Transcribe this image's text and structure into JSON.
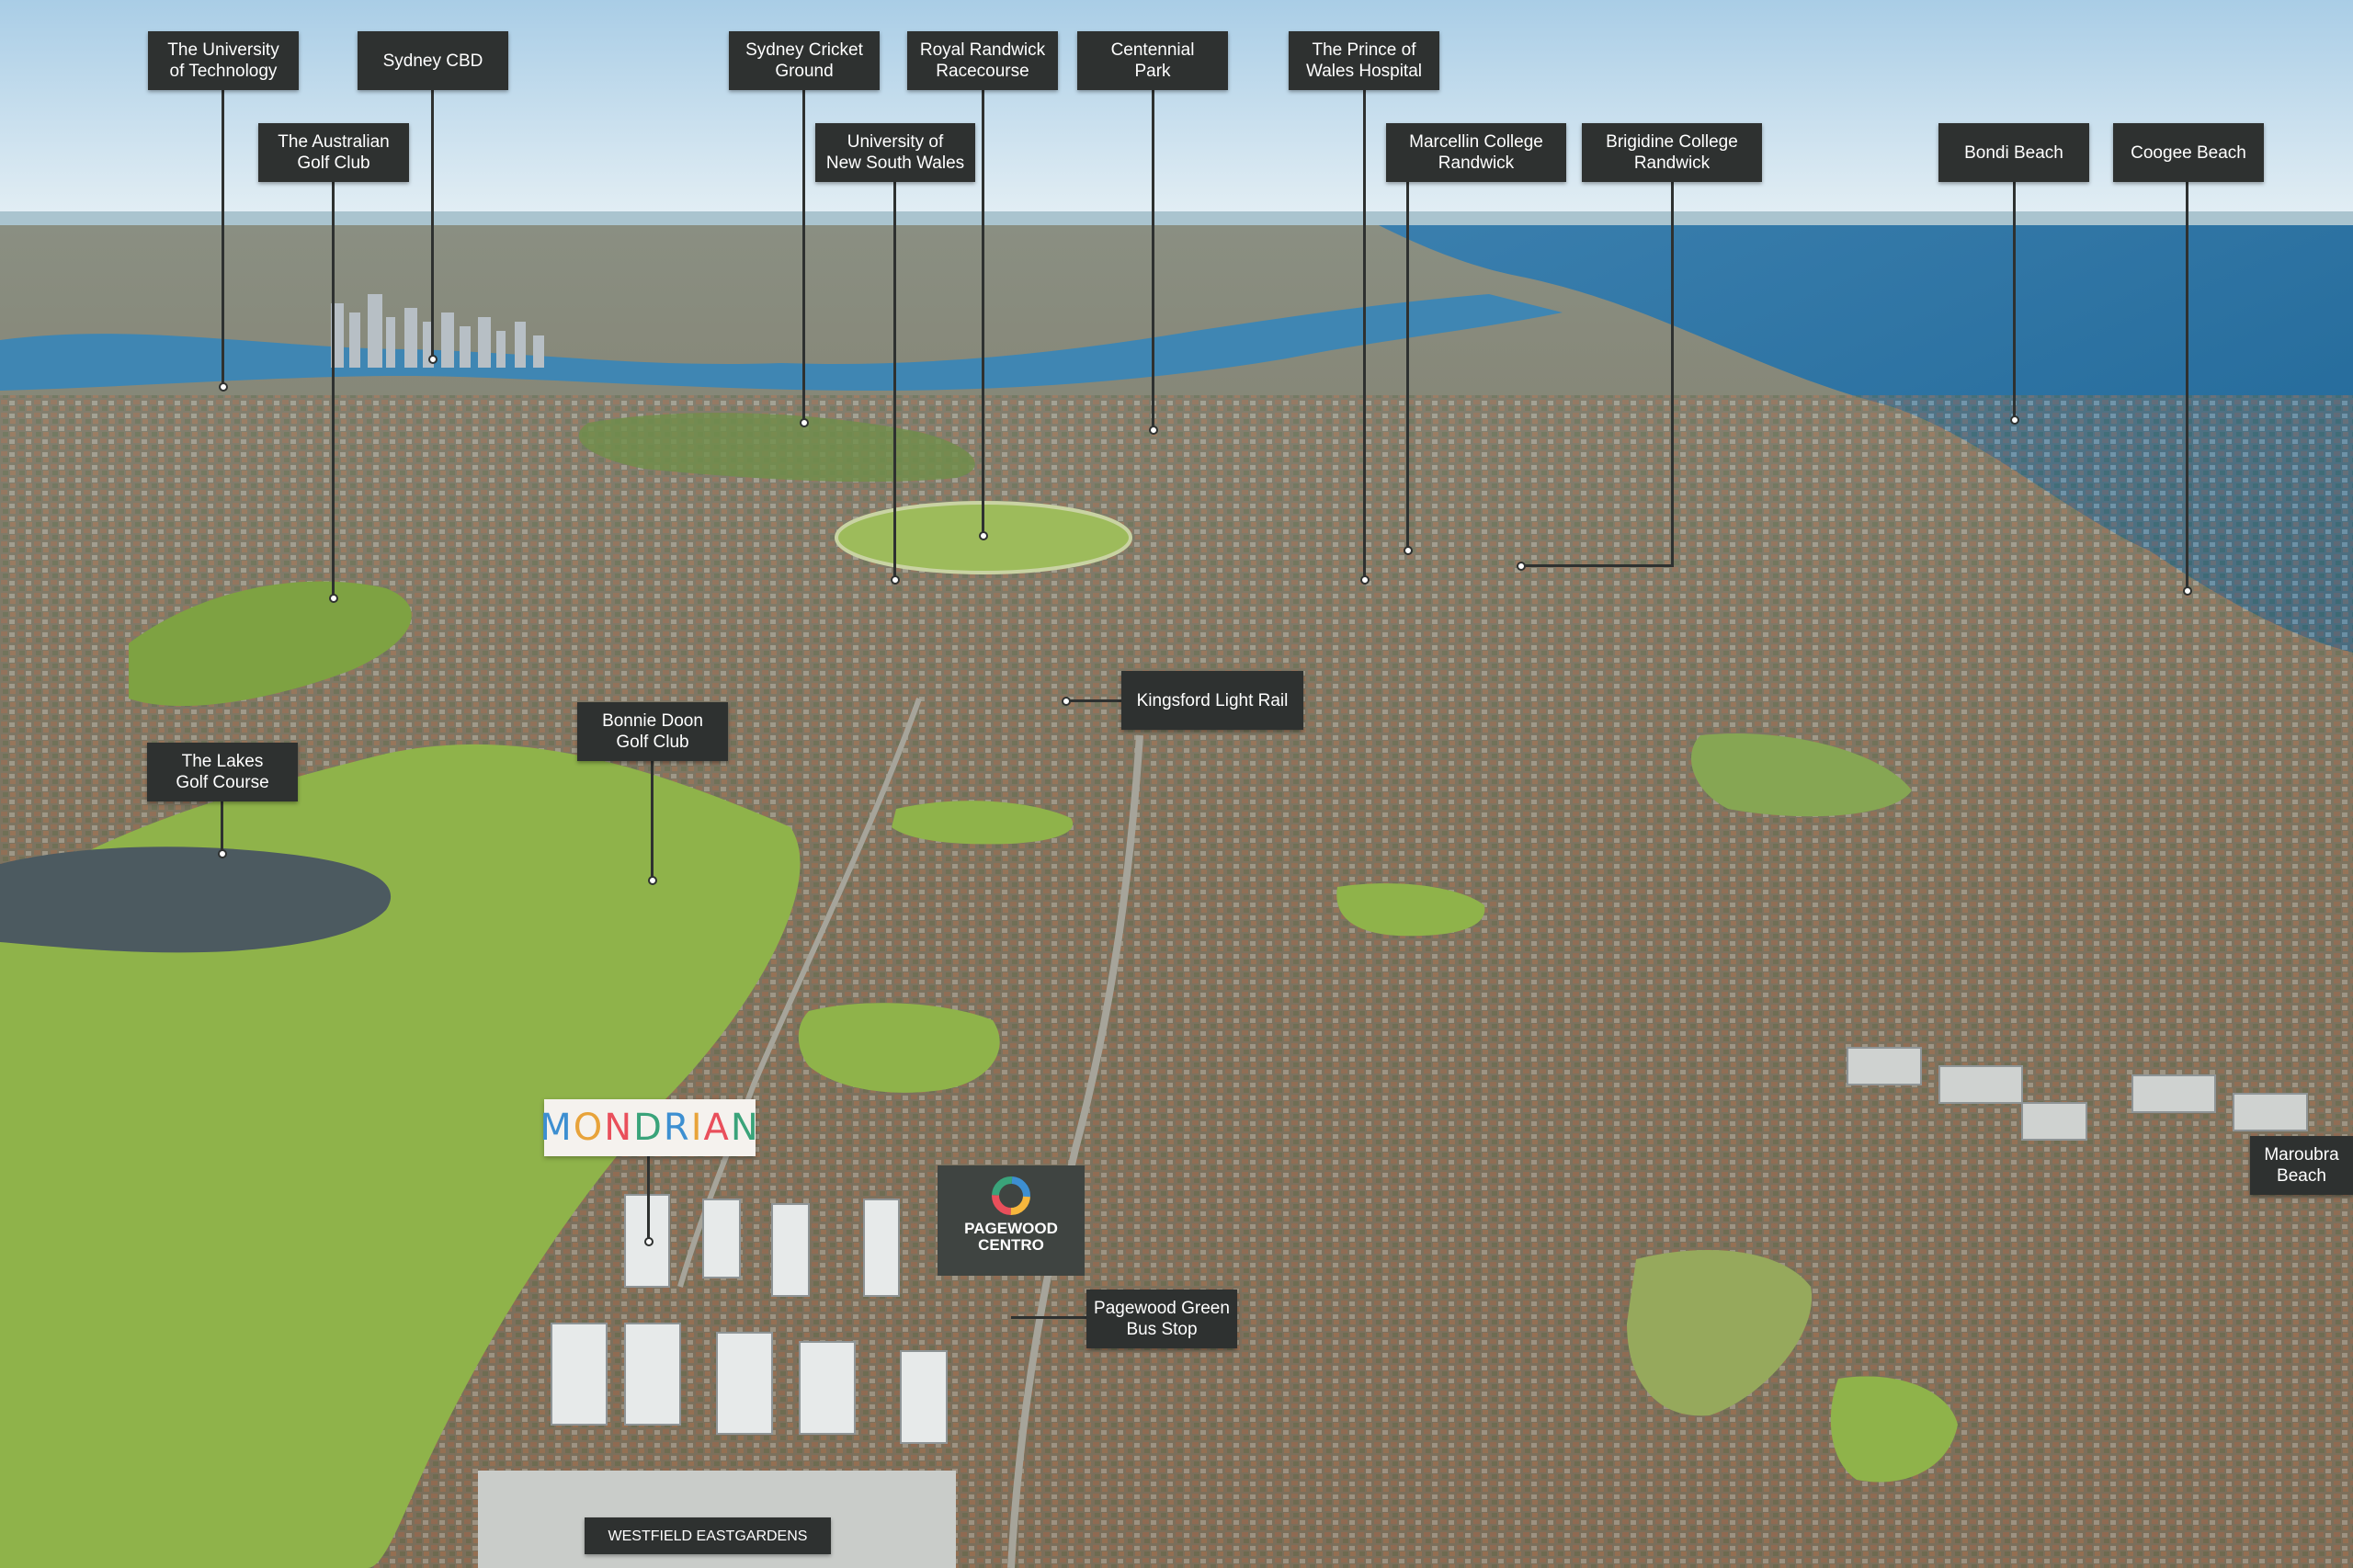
{
  "labels": {
    "uts": "The University\nof Technology",
    "sydney_cbd": "Sydney CBD",
    "australian_golf_club": "The Australian\nGolf Club",
    "scg": "Sydney Cricket\nGround",
    "royal_randwick": "Royal Randwick\nRacecourse",
    "centennial_park": "Centennial\nPark",
    "unsw": "University of\nNew South Wales",
    "prince_of_wales": "The Prince of\nWales Hospital",
    "marcellin": "Marcellin College\nRandwick",
    "brigidine": "Brigidine College\nRandwick",
    "bondi": "Bondi Beach",
    "coogee": "Coogee Beach",
    "kingsford": "Kingsford Light Rail",
    "bonnie_doon": "Bonnie Doon\nGolf Club",
    "lakes_golf": "The Lakes\nGolf Course",
    "maroubra": "Maroubra\nBeach",
    "pagewood_bus": "Pagewood Green\nBus Stop",
    "westfield": "WESTFIELD EASTGARDENS"
  },
  "logo": {
    "text": "MONDRIAN",
    "letter_colors": [
      "#3d8fd1",
      "#e8a33a",
      "#e94f5b",
      "#3aa37a",
      "#3d8fd1",
      "#e8a33a",
      "#e94f5b",
      "#3aa37a"
    ]
  },
  "centro": {
    "line1": "PAGEWOOD",
    "line2": "CENTRO"
  },
  "colors": {
    "sky": "#cfe4f1",
    "ocean": "#2f77a8",
    "harbour": "#3f86b3",
    "suburbs": "#7b7766",
    "golf_green": "#8fb34a",
    "label_bg": "#2e3130",
    "lake": "#4c5a60"
  }
}
